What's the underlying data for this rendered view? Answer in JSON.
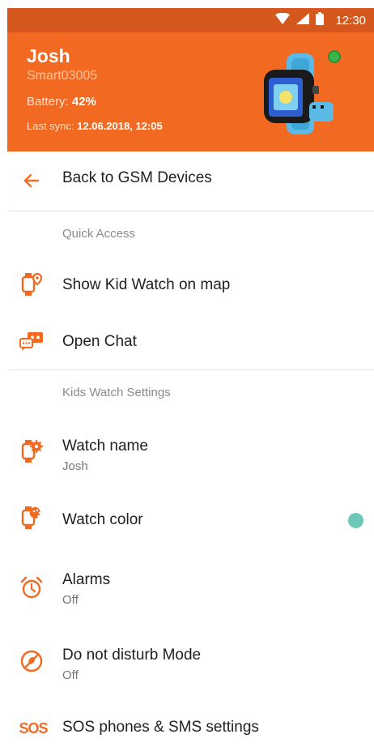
{
  "status_bar": {
    "time": "12:30"
  },
  "header": {
    "name": "Josh",
    "device_id": "Smart03005",
    "battery_label": "Battery:",
    "battery_value": "42%",
    "sync_label": "Last sync:",
    "sync_value": "12.06.2018, 12:05",
    "online_color": "#39b54a"
  },
  "nav": {
    "back_label": "Back to GSM Devices"
  },
  "quick_access": {
    "title": "Quick Access",
    "show_on_map": "Show Kid Watch on map",
    "open_chat": "Open Chat"
  },
  "settings": {
    "title": "Kids Watch Settings",
    "watch_name_label": "Watch name",
    "watch_name_value": "Josh",
    "watch_color_label": "Watch color",
    "watch_color_value": "#6cc7b9",
    "alarms_label": "Alarms",
    "alarms_value": "Off",
    "dnd_label": "Do not disturb Mode",
    "dnd_value": "Off",
    "sos_icon_text": "SOS",
    "sos_label": "SOS phones & SMS settings"
  },
  "colors": {
    "accent": "#f26a21",
    "status_bar": "#d4581d"
  }
}
